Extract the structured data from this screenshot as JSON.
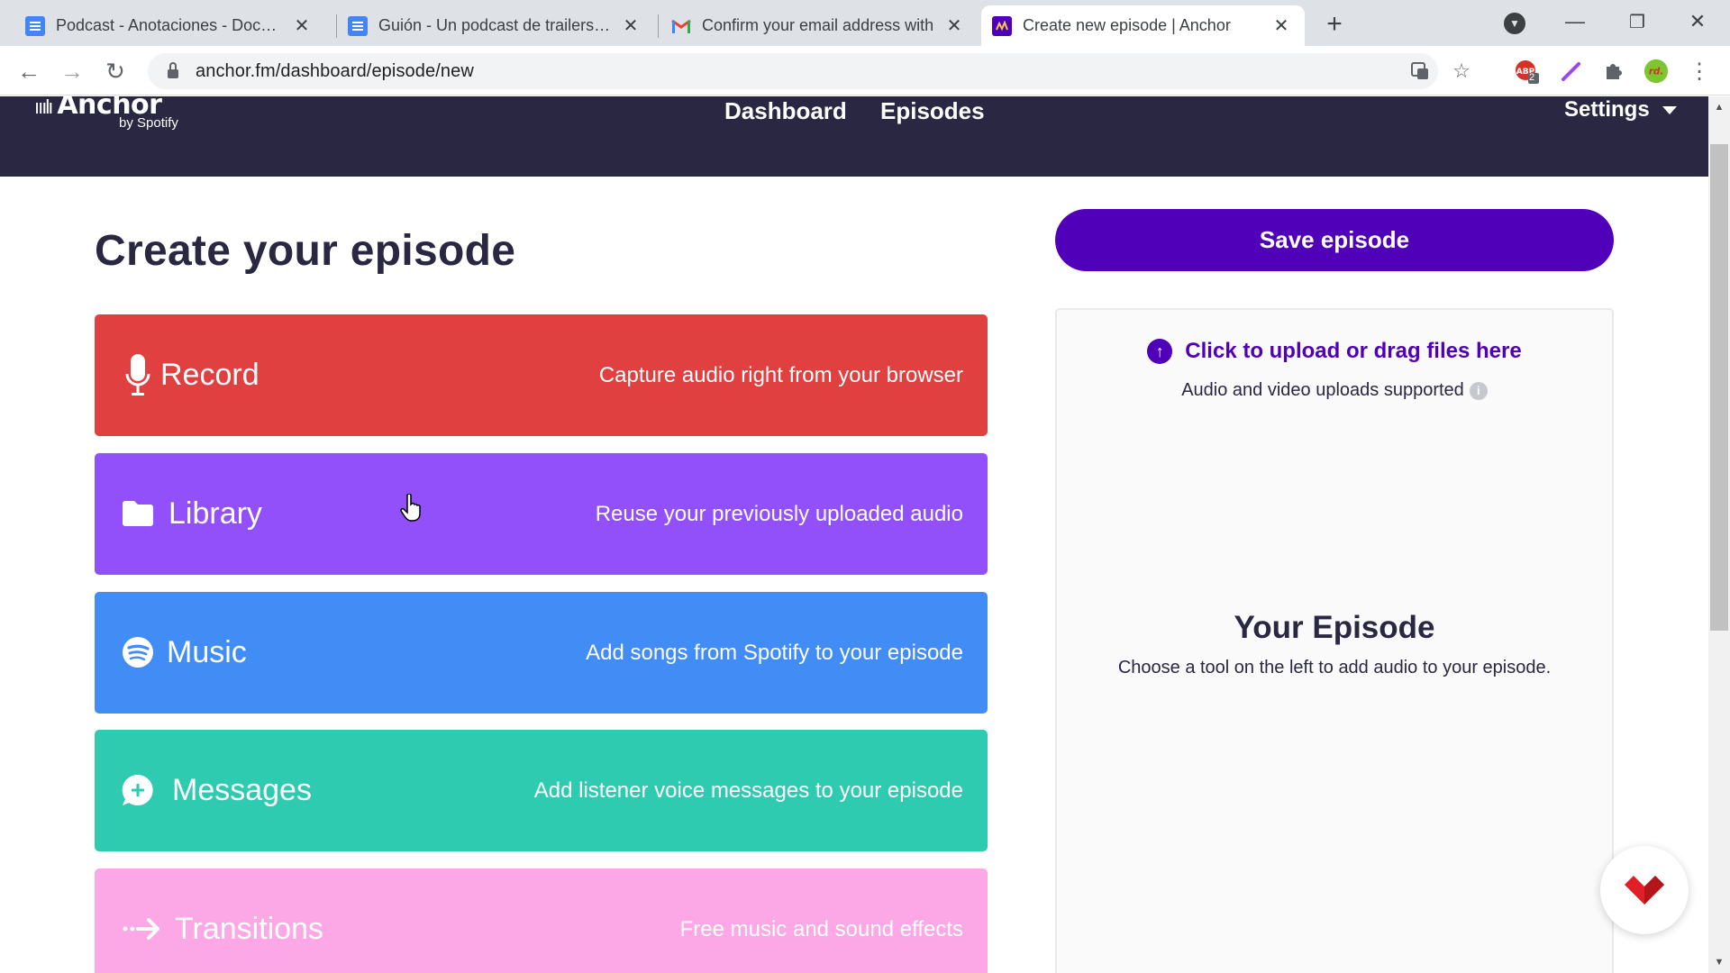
{
  "browser": {
    "tabs": [
      {
        "title": "Podcast - Anotaciones - Docume",
        "icon": "google-docs-icon",
        "active": false
      },
      {
        "title": "Guión - Un podcast de trailers - I",
        "icon": "google-docs-icon",
        "active": false
      },
      {
        "title": "Confirm your email address with",
        "icon": "gmail-icon",
        "active": false
      },
      {
        "title": "Create new episode | Anchor",
        "icon": "anchor-icon",
        "active": true
      }
    ],
    "url": "anchor.fm/dashboard/episode/new",
    "extension_badge": "2"
  },
  "header": {
    "logo_text": "Anchor",
    "logo_sub": "by Spotify",
    "nav": [
      "Dashboard",
      "Episodes"
    ],
    "settings_label": "Settings"
  },
  "main": {
    "title": "Create your episode",
    "tools": [
      {
        "name": "Record",
        "description": "Capture audio right from your browser",
        "color": "#e04040",
        "icon": "microphone-icon"
      },
      {
        "name": "Library",
        "description": "Reuse your previously uploaded audio",
        "color": "#9150fa",
        "icon": "folder-icon"
      },
      {
        "name": "Music",
        "description": "Add songs from Spotify to your episode",
        "color": "#418cf5",
        "icon": "spotify-icon"
      },
      {
        "name": "Messages",
        "description": "Add listener voice messages to your episode",
        "color": "#2fcbb0",
        "icon": "message-plus-icon"
      },
      {
        "name": "Transitions",
        "description": "Free music and sound effects",
        "color": "#fda8e6",
        "icon": "arrow-right-icon"
      }
    ]
  },
  "sidebar": {
    "save_label": "Save episode",
    "upload_label": "Click to upload or drag files here",
    "upload_sub": "Audio and video uploads supported",
    "episode_title": "Your Episode",
    "episode_sub": "Choose a tool on the left to add audio to your episode."
  },
  "colors": {
    "header_bg": "#292741",
    "accent": "#5000b9"
  }
}
